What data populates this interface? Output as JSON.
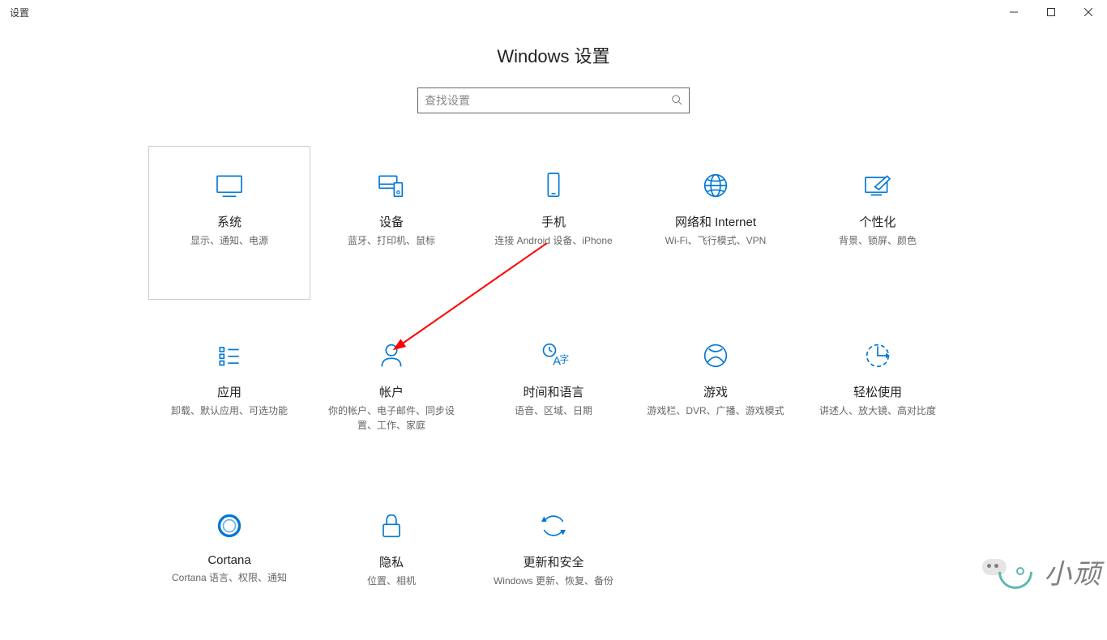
{
  "window": {
    "title": "设置"
  },
  "page": {
    "heading": "Windows 设置"
  },
  "search": {
    "placeholder": "查找设置"
  },
  "tiles": [
    {
      "id": "system",
      "title": "系统",
      "desc": "显示、通知、电源",
      "selected": true
    },
    {
      "id": "devices",
      "title": "设备",
      "desc": "蓝牙、打印机、鼠标",
      "selected": false
    },
    {
      "id": "phone",
      "title": "手机",
      "desc": "连接 Android 设备、iPhone",
      "selected": false
    },
    {
      "id": "network",
      "title": "网络和 Internet",
      "desc": "Wi-Fi、飞行模式、VPN",
      "selected": false
    },
    {
      "id": "personalization",
      "title": "个性化",
      "desc": "背景、锁屏、颜色",
      "selected": false
    },
    {
      "id": "apps",
      "title": "应用",
      "desc": "卸载、默认应用、可选功能",
      "selected": false
    },
    {
      "id": "accounts",
      "title": "帐户",
      "desc": "你的帐户、电子邮件、同步设置、工作、家庭",
      "selected": false
    },
    {
      "id": "time-language",
      "title": "时间和语言",
      "desc": "语音、区域、日期",
      "selected": false
    },
    {
      "id": "gaming",
      "title": "游戏",
      "desc": "游戏栏、DVR、广播、游戏模式",
      "selected": false
    },
    {
      "id": "ease-of-access",
      "title": "轻松使用",
      "desc": "讲述人、放大镜、高对比度",
      "selected": false
    },
    {
      "id": "cortana",
      "title": "Cortana",
      "desc": "Cortana 语言、权限、通知",
      "selected": false
    },
    {
      "id": "privacy",
      "title": "隐私",
      "desc": "位置、相机",
      "selected": false
    },
    {
      "id": "update",
      "title": "更新和安全",
      "desc": "Windows 更新、恢复、备份",
      "selected": false
    }
  ],
  "watermark": {
    "text": "小顽"
  },
  "colors": {
    "accent": "#0078d7",
    "annotation": "#ff0000"
  }
}
